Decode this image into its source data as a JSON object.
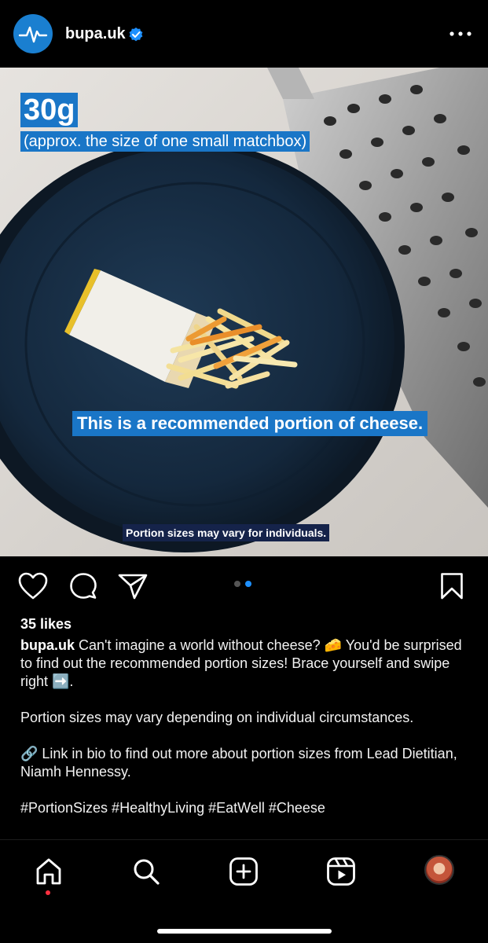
{
  "header": {
    "username": "bupa.uk",
    "verified_icon": "verified-badge-icon",
    "more_icon": "more-options-icon"
  },
  "post": {
    "image_labels": {
      "weight": "30g",
      "comparison": "(approx. the size of one small matchbox)",
      "statement": "This is a recommended portion of cheese.",
      "disclaimer": "Portion sizes may vary for individuals."
    },
    "carousel": {
      "total": 2,
      "current": 2
    }
  },
  "actions": {
    "like_icon": "heart-icon",
    "comment_icon": "comment-icon",
    "share_icon": "send-icon",
    "save_icon": "bookmark-icon"
  },
  "likes": "35 likes",
  "caption": {
    "username": "bupa.uk",
    "line1": " Can't imagine a world without cheese? 🧀 You'd be surprised to find out the recommended portion sizes! Brace yourself and swipe right ➡️.",
    "line2": "Portion sizes may vary depending on individual circumstances.",
    "line3": "🔗 Link in bio to find out more about portion sizes from Lead Dietitian, Niamh Hennessy.",
    "hashtags": "#PortionSizes #HealthyLiving #EatWell #Cheese"
  },
  "nav": {
    "items": [
      "home-icon",
      "search-icon",
      "create-icon",
      "reels-icon",
      "profile-avatar"
    ]
  },
  "colors": {
    "brand_blue": "#1a76c7",
    "active_dot": "#1e90ff",
    "notification": "#ff3040"
  }
}
